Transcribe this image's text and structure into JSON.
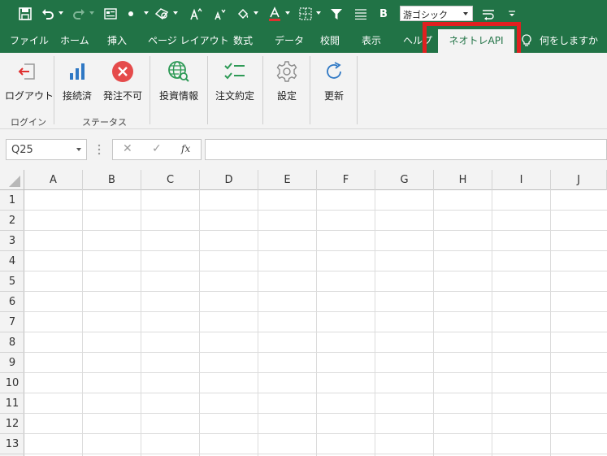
{
  "quick_access": {
    "font_name": "游ゴシック",
    "icons": [
      "save-icon",
      "undo-icon",
      "redo-icon",
      "form-icon",
      "bullet-icon",
      "shape-icon",
      "grow-font-icon",
      "shrink-font-icon",
      "fill-color-icon",
      "font-color-icon",
      "borders-icon",
      "filter-icon",
      "align-icon",
      "bold-icon",
      "wrap-icon",
      "more-icon"
    ]
  },
  "ribbon_tabs": [
    "ファイル",
    "ホーム",
    "挿入",
    "ページ レイアウト",
    "数式",
    "データ",
    "校閲",
    "表示",
    "ヘルプ",
    "ネオトレAPI"
  ],
  "tell_me": "何をしますか",
  "ribbon": {
    "buttons": [
      {
        "label": "ログアウト",
        "icon": "logout-icon"
      },
      {
        "label": "接続済",
        "icon": "signal-bars-icon"
      },
      {
        "label": "発注不可",
        "icon": "error-circle-icon"
      },
      {
        "label": "投資情報",
        "icon": "globe-search-icon"
      },
      {
        "label": "注文約定",
        "icon": "checklist-icon"
      },
      {
        "label": "設定",
        "icon": "gear-icon"
      },
      {
        "label": "更新",
        "icon": "refresh-icon"
      }
    ],
    "groups": [
      "ログイン",
      "ステータス"
    ]
  },
  "formula_bar": {
    "name_box": "Q25",
    "cancel": "✕",
    "enter": "✓",
    "fx": "fx",
    "value": ""
  },
  "columns": [
    "A",
    "B",
    "C",
    "D",
    "E",
    "F",
    "G",
    "H",
    "I",
    "J"
  ],
  "rows": [
    "1",
    "2",
    "3",
    "4",
    "5",
    "6",
    "7",
    "8",
    "9",
    "10",
    "11",
    "12",
    "13"
  ],
  "colors": {
    "excel_green": "#217346",
    "highlight_red": "#e02020",
    "ribbon_bg": "#f3f3f3"
  }
}
